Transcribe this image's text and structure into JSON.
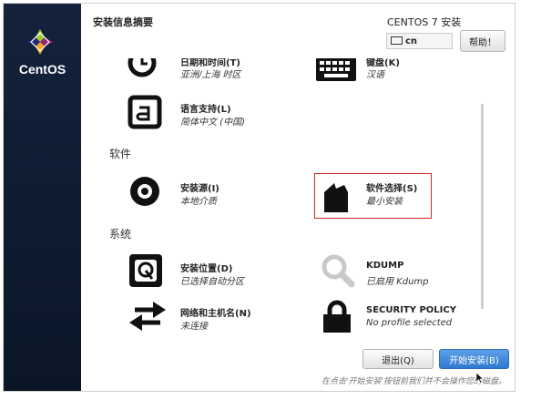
{
  "sidebar": {
    "logo_text": "CentOS"
  },
  "header": {
    "title": "安装信息摘要",
    "product": "CENTOS 7 安装",
    "keyboard_layout": "cn",
    "help_label": "帮助！"
  },
  "sections": {
    "software": "软件",
    "system": "系统"
  },
  "spokes": {
    "datetime": {
      "name": "日期和时间(T)",
      "status": "亚洲/上海 时区",
      "icon": "clock-icon"
    },
    "keyboard": {
      "name": "键盘(K)",
      "status": "汉语",
      "icon": "keyboard-icon"
    },
    "language": {
      "name": "语言支持(L)",
      "status": "简体中文 (中国)",
      "icon": "language-icon"
    },
    "source": {
      "name": "安装源(I)",
      "status": "本地介质",
      "icon": "disc-icon"
    },
    "software": {
      "name": "软件选择(S)",
      "status": "最小安装",
      "icon": "package-icon"
    },
    "destination": {
      "name": "安装位置(D)",
      "status": "已选择自动分区",
      "icon": "disk-icon"
    },
    "kdump": {
      "name": "KDUMP",
      "status": "已启用 Kdump",
      "icon": "search-icon"
    },
    "network": {
      "name": "网络和主机名(N)",
      "status": "未连接",
      "icon": "network-arrows-icon"
    },
    "security": {
      "name": "SECURITY POLICY",
      "status": "No profile selected",
      "icon": "lock-icon"
    }
  },
  "footer": {
    "quit_label": "退出(Q)",
    "begin_label": "开始安装(B)",
    "note": "在点击'开始安装'按钮前我们并不会操作您的磁盘。"
  },
  "colors": {
    "sidebar": "#14223c",
    "accent": "#2f78d0",
    "selection": "#cc2b2b"
  }
}
